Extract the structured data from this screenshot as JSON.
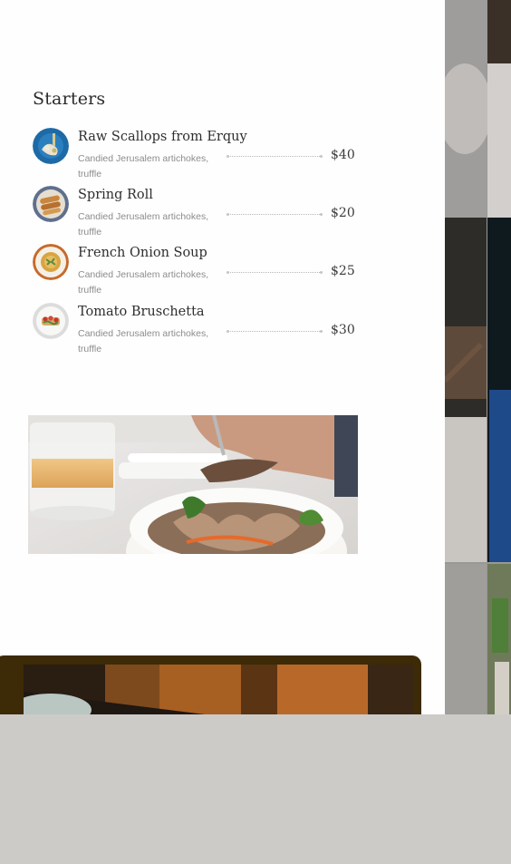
{
  "starters": {
    "title": "Starters",
    "items": [
      {
        "name": "Raw Scallops from Erquy",
        "description": "Candied Jerusalem artichokes, truffle",
        "price": "$40"
      },
      {
        "name": "Spring Roll",
        "description": "Candied Jerusalem artichokes, truffle",
        "price": "$20"
      },
      {
        "name": "French Onion Soup",
        "description": "Candied Jerusalem artichokes, truffle",
        "price": "$25"
      },
      {
        "name": "Tomato Bruschetta",
        "description": "Candied Jerusalem artichokes, truffle",
        "price": "$30"
      }
    ]
  },
  "images": {
    "feature_photo": "salad-bowl-with-fork",
    "bottom_photo": "restaurant-interior-wood",
    "side_photos": "restaurant-gallery-strip"
  },
  "colors": {
    "page_bg": "#fefefe",
    "outer_bg": "#cdcbc8",
    "card_brown": "#3d2a06",
    "text_dark": "#2e2e2e",
    "text_muted": "#8c8c8c"
  }
}
